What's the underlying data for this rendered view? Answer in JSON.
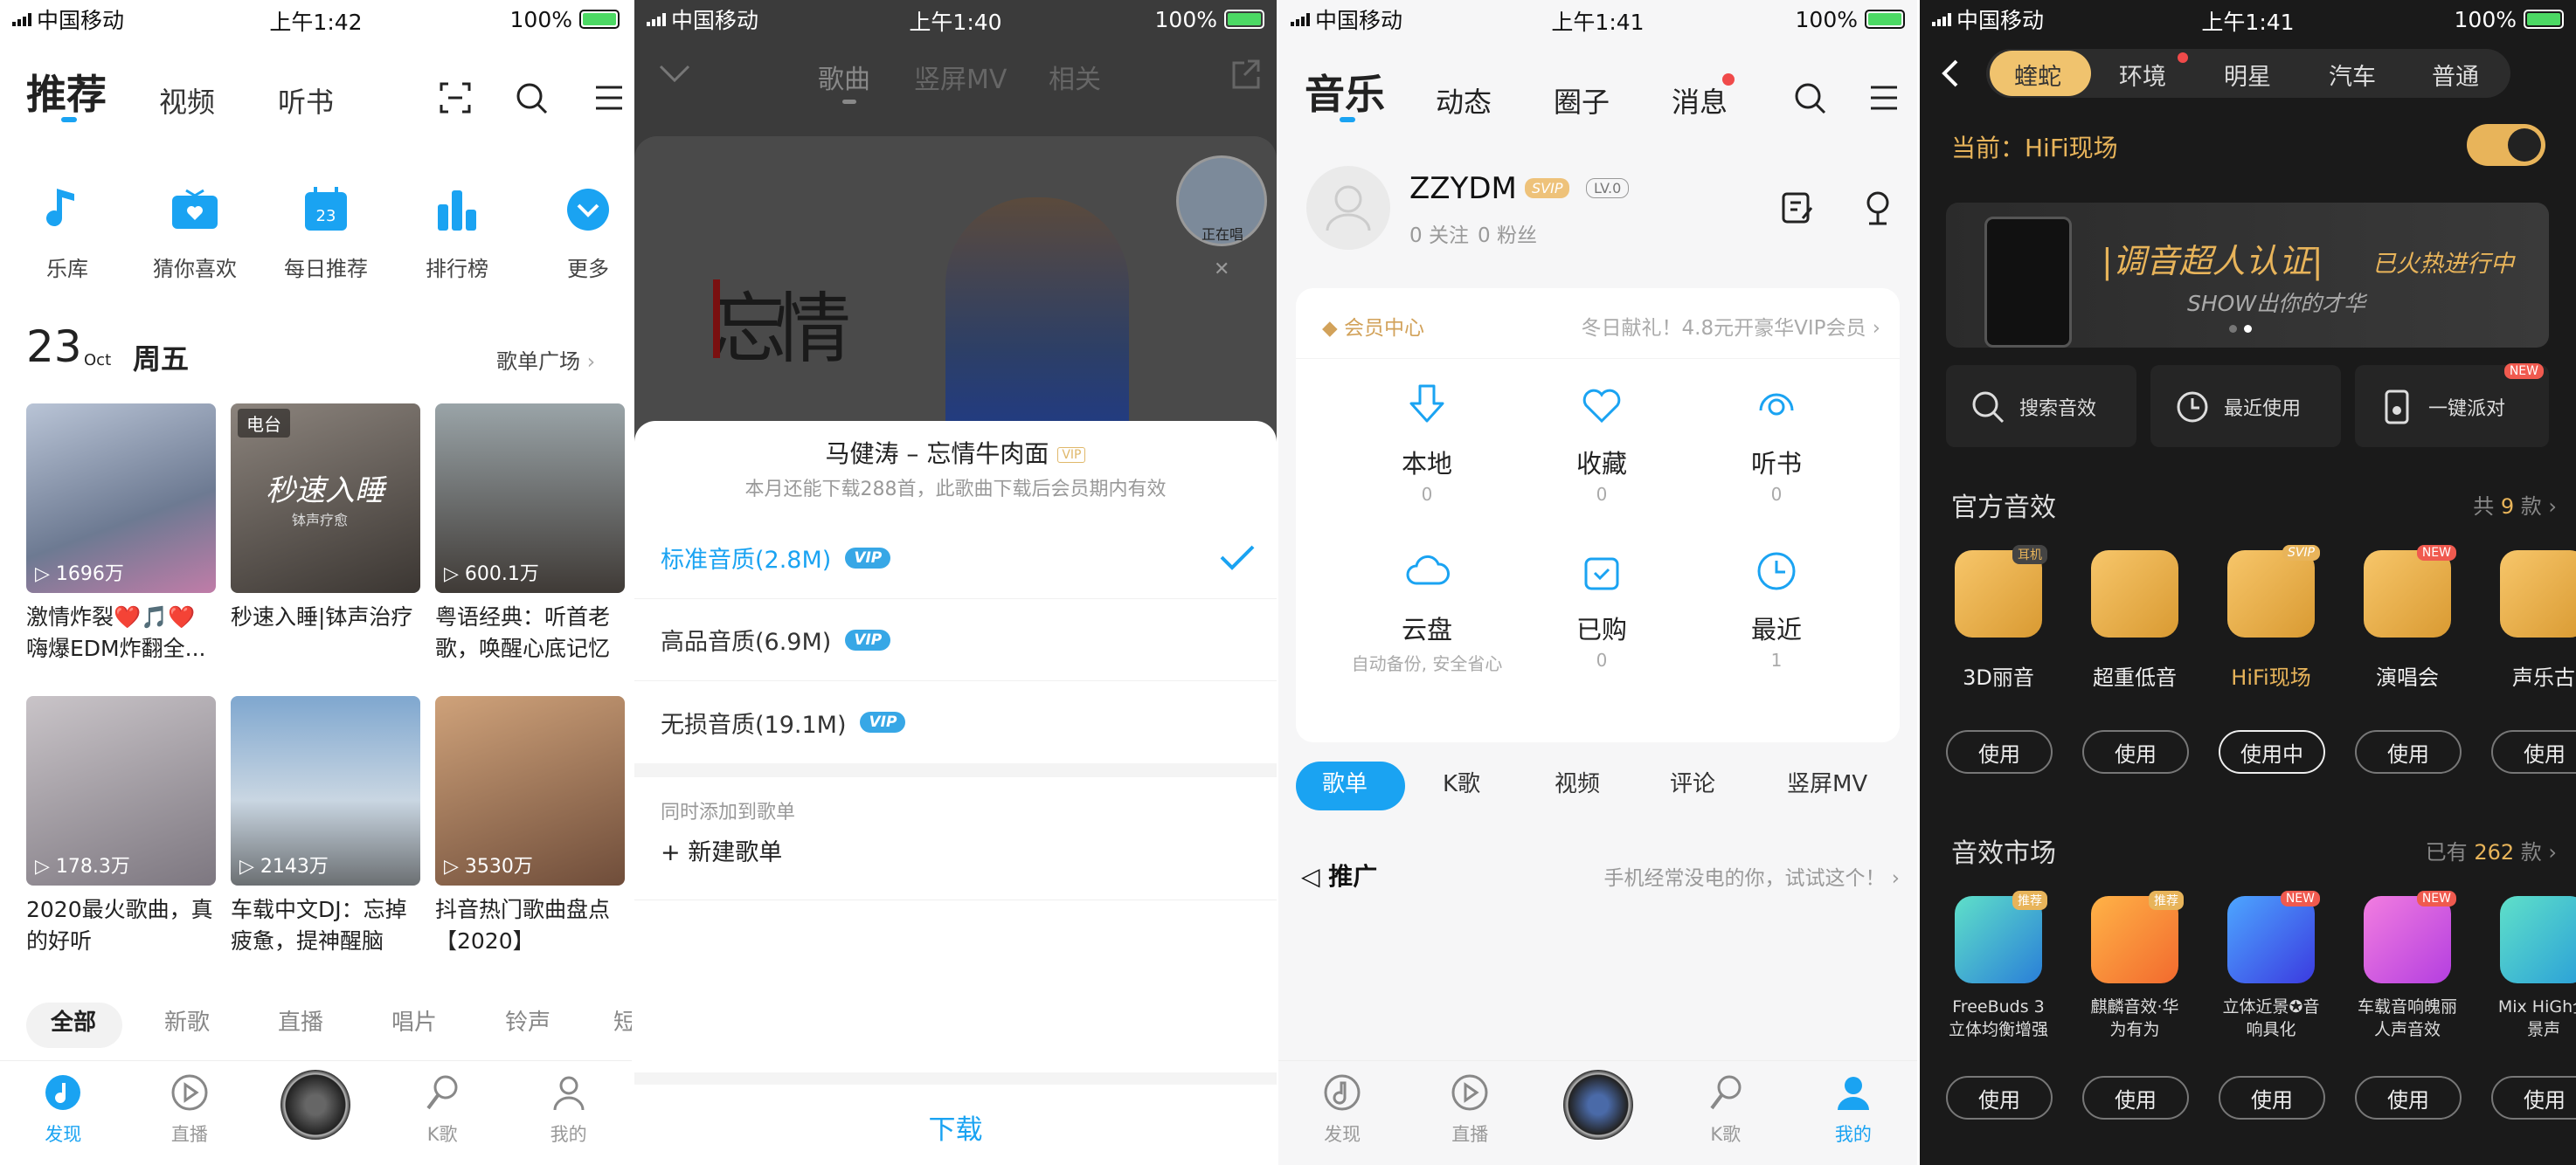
{
  "status": {
    "carrier": "中国移动",
    "battery": "100%",
    "times": [
      "上午1:42",
      "上午1:40",
      "上午1:41",
      "上午1:41"
    ]
  },
  "s1": {
    "tabs": [
      "推荐",
      "视频",
      "听书"
    ],
    "quick": [
      "乐库",
      "猜你喜欢",
      "每日推荐",
      "排行榜",
      "更多"
    ],
    "calendar_day": "23",
    "date_day": "23",
    "date_month": "Oct",
    "weekday": "周五",
    "playlist_square": "歌单广场",
    "cards": [
      {
        "plays": "1696万",
        "title": "激情炸裂❤️🎵❤️嗨爆EDM炸翻全...",
        "tag": ""
      },
      {
        "plays": "",
        "title": "秒速入睡|钵声治疗",
        "tag": "电台",
        "img_text": "秒速入睡",
        "img_sub": "钵声疗愈"
      },
      {
        "plays": "600.1万",
        "title": "粤语经典：听首老歌，唤醒心底记忆",
        "tag": ""
      },
      {
        "plays": "178.3万",
        "title": "2020最火歌曲，真的好听",
        "tag": ""
      },
      {
        "plays": "2143万",
        "title": "车载中文DJ：忘掉疲惫，提神醒脑",
        "tag": ""
      },
      {
        "plays": "3530万",
        "title": "抖音热门歌曲盘点【2020】",
        "tag": ""
      }
    ],
    "filters": [
      "全部",
      "新歌",
      "直播",
      "唱片",
      "铃声",
      "短"
    ],
    "nav": [
      "发现",
      "直播",
      "",
      "K歌",
      "我的"
    ]
  },
  "s2": {
    "tabs": [
      "歌曲",
      "竖屏MV",
      "相关"
    ],
    "poster_char1": "忘",
    "poster_char2": "情",
    "playing_label": "正在唱",
    "song_title": "马健涛 – 忘情牛肉面",
    "vip_small": "VIP",
    "subtitle": "本月还能下载288首，此歌曲下载后会员期内有效",
    "options": [
      {
        "label": "标准音质(2.8M)",
        "badge": "VIP",
        "selected": true
      },
      {
        "label": "高品音质(6.9M)",
        "badge": "VIP",
        "selected": false
      },
      {
        "label": "无损音质(19.1M)",
        "badge": "VIP",
        "selected": false
      }
    ],
    "add_to": "同时添加到歌单",
    "new_playlist": "+ 新建歌单",
    "download": "下载"
  },
  "s3": {
    "tabs": [
      "音乐",
      "动态",
      "圈子",
      "消息"
    ],
    "username": "ZZYDM",
    "svip": "SVIP",
    "level": "LV.0",
    "follow": "0 关注",
    "fans": "0 粉丝",
    "vip_center": "会员中心",
    "vip_promo": "冬日献礼！4.8元开豪华VIP会员",
    "grid": [
      {
        "label": "本地",
        "count": "0"
      },
      {
        "label": "收藏",
        "count": "0"
      },
      {
        "label": "听书",
        "count": "0"
      },
      {
        "label": "云盘",
        "count": "自动备份, 安全省心"
      },
      {
        "label": "已购",
        "count": "0"
      },
      {
        "label": "最近",
        "count": "1"
      }
    ],
    "chips": [
      "歌单",
      "K歌",
      "视频",
      "评论",
      "竖屏MV"
    ],
    "promo_label": "推广",
    "promo_text": "手机经常没电的你，试试这个！",
    "nav": [
      "发现",
      "直播",
      "",
      "K歌",
      "我的"
    ]
  },
  "s4": {
    "tabs": [
      "蝰蛇",
      "环境",
      "明星",
      "汽车",
      "普通"
    ],
    "current": "当前：HiFi现场",
    "toggle_on": true,
    "banner_title": "|调音超人认证|",
    "banner_hot": "已火热进行中",
    "banner_sub": "SHOW出你的才华",
    "banner_pages": 2,
    "banner_active_page": 2,
    "tools": [
      "搜索音效",
      "最近使用",
      "一键派对"
    ],
    "tool_badge": "NEW",
    "official_title": "官方音效",
    "official_count_pre": "共",
    "official_count": "9",
    "official_count_post": "款",
    "official": [
      {
        "label": "3D丽音",
        "badge": "耳机",
        "btn": "使用"
      },
      {
        "label": "超重低音",
        "badge": "",
        "btn": "使用"
      },
      {
        "label": "HiFi现场",
        "badge": "SVIP",
        "btn": "使用中",
        "active": true
      },
      {
        "label": "演唱会",
        "badge": "NEW",
        "btn": "使用"
      },
      {
        "label": "声乐古",
        "badge": "",
        "btn": "使用"
      }
    ],
    "market_title": "音效市场",
    "market_count_pre": "已有",
    "market_count": "262",
    "market_count_post": "款",
    "market": [
      {
        "label": "FreeBuds 3立体均衡增强",
        "badge": "推荐",
        "btn": "使用"
      },
      {
        "label": "麒麟音效·华为有为",
        "badge": "推荐",
        "btn": "使用"
      },
      {
        "label": "立体近景✪音响具化",
        "badge": "NEW",
        "btn": "使用"
      },
      {
        "label": "车载音响魄丽人声音效",
        "badge": "NEW",
        "btn": "使用"
      },
      {
        "label": "Mix HiGh全景声",
        "badge": "",
        "btn": "使用"
      }
    ]
  },
  "colors": {
    "accent": "#1aa3f2",
    "gold": "#e8b45a",
    "dark_bg": "#1a1a1a"
  }
}
